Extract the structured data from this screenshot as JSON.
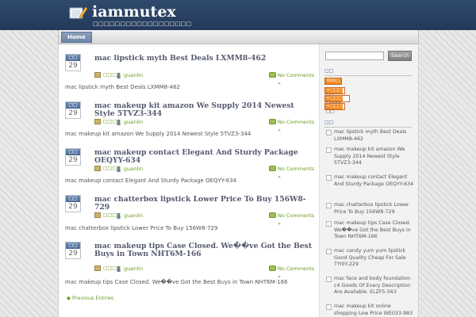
{
  "site": {
    "title": "iammutex",
    "description": "□□□□□□□□□□□□□□□□□□"
  },
  "nav": {
    "home_label": "Home"
  },
  "posts": [
    {
      "month": "□□",
      "day": "29",
      "title": "mac lipstick myth Best Deals LXMM8-462",
      "category": "□□□□",
      "author": "guanlin",
      "comments": "No Comments »",
      "excerpt": "mac lipstick myth Best Deals LXMM8-462"
    },
    {
      "month": "□□",
      "day": "29",
      "title": "mac makeup kit amazon We Supply 2014 Newest Style 5TVZ3-344",
      "category": "□□□□",
      "author": "guanlin",
      "comments": "No Comments »",
      "excerpt": "mac makeup kit amazon We Supply 2014 Newest Style 5TVZ3-344"
    },
    {
      "month": "□□",
      "day": "29",
      "title": "mac makeup contact Elegant And Sturdy Package OEQYY-634",
      "category": "□□□□",
      "author": "guanlin",
      "comments": "No Comments »",
      "excerpt": "mac makeup contact Elegant And Sturdy Package OEQYY-634"
    },
    {
      "month": "□□",
      "day": "29",
      "title": "mac chatterbox lipstick Lower Price To Buy 156W8-729",
      "category": "□□□□",
      "author": "guanlin",
      "comments": "No Comments »",
      "excerpt": "mac chatterbox lipstick Lower Price To Buy 156W8-729"
    },
    {
      "month": "□□",
      "day": "29",
      "title": "mac makeup tips Case Closed. We��ve Got the Best Buys in Town NHT6M-166",
      "category": "□□□□",
      "author": "guanlin",
      "comments": "No Comments »",
      "excerpt": "mac makeup tips Case Closed. We��ve Got the Best Buys in Town NHT6M-166"
    }
  ],
  "pagination": {
    "prev_label": "Previous Entries"
  },
  "sidebar": {
    "search_placeholder": "",
    "search_button": "Search",
    "subscribe_title": "□□",
    "rss_label": "RSS□",
    "badges": [
      {
        "tag": "+□□□",
        "name": "□□"
      },
      {
        "tag": "+□□□",
        "name": "Google"
      },
      {
        "tag": "+□□□",
        "name": "□□"
      }
    ],
    "recent_title": "□□",
    "recent_items": [
      "mac lipstick myth Best Deals LXMM8-462",
      "mac makeup kit amazon We Supply 2014 Newest Style 5TVZ3-344",
      "mac makeup contact Elegant And Sturdy Package OEQYY-634",
      "mac chatterbox lipstick Lower Price To Buy 156W8-729",
      "mac makeup tips Case Closed. We��ve Got the Best Buys in Town NHT6M-166",
      "mac candy yum yum lipstick Good Quality Cheap For Sale TYI0Y-229",
      "mac face and body foundation c4 Goods Of Every Description Are Available. ELZF5-563",
      "mac makeup kit online shopping Low Price WE033-983"
    ]
  },
  "colors": {
    "header_bg": "#2b4466",
    "link_green": "#6f9a22",
    "title_color": "#555a70",
    "accent_blue": "#4a6a96"
  }
}
